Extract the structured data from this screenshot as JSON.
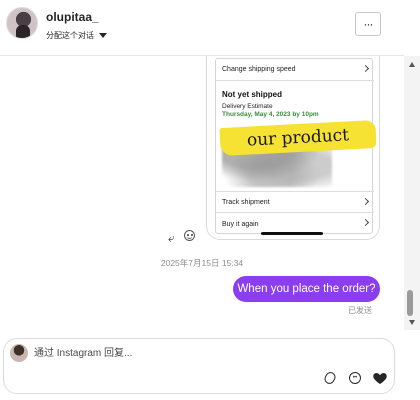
{
  "header": {
    "username": "olupitaa_",
    "assign_label": "分配这个对话",
    "more_label": "···"
  },
  "shared_order": {
    "change_speed": "Change shipping speed",
    "status": "Not yet shipped",
    "estimate_label": "Delivery Estimate",
    "estimate_date": "Thursday, May 4, 2023 by 10pm",
    "overlay_text": "our product",
    "track": "Track shipment",
    "buy_again": "Buy it again"
  },
  "thread": {
    "timestamp": "2025年7月15日 15:34",
    "message": "When you place the order?",
    "sent_status": "已发送"
  },
  "composer": {
    "placeholder": "通过 Instagram 回复..."
  },
  "icons": {
    "reply": "reply-icon",
    "reaction": "emoji-icon",
    "attach": "paperclip-icon",
    "sticker": "sticker-icon",
    "like": "heart-icon",
    "more": "more-icon"
  },
  "colors": {
    "bubble": "#8b3ef0",
    "highlight": "#f6e233",
    "estimate_green": "#3b8d3b"
  }
}
